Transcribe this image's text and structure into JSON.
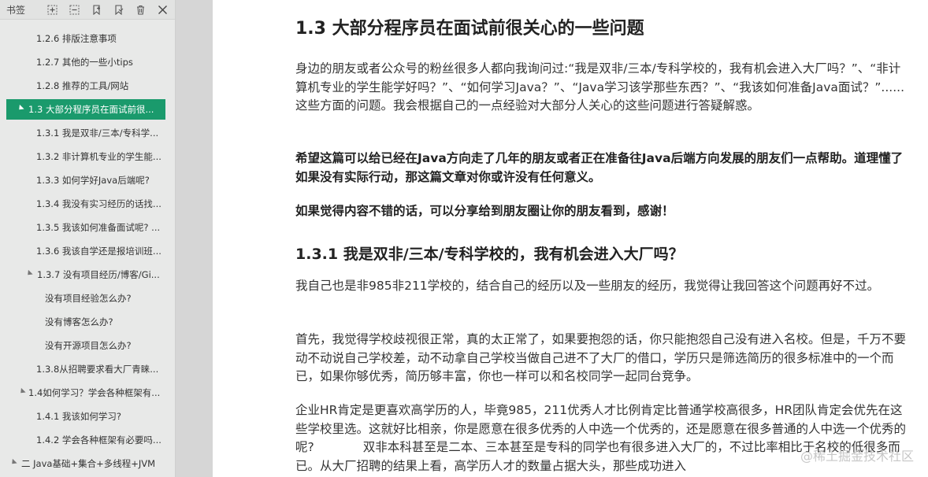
{
  "sidebar": {
    "title": "书签",
    "tools": [
      "expand-all-icon",
      "collapse-all-icon",
      "add-bookmark-icon",
      "bookmark-option-icon",
      "delete-icon",
      "close-icon"
    ],
    "items": [
      {
        "label": "1.2.6 排版注意事项"
      },
      {
        "label": "1.2.7 其他的一些小tips"
      },
      {
        "label": "1.2.8 推荐的工具/网站"
      },
      {
        "label": "1.3 大部分程序员在面试前很..."
      },
      {
        "label": "1.3.1 我是双非/三本/专科学..."
      },
      {
        "label": "1.3.2 非计算机专业的学生能..."
      },
      {
        "label": "1.3.3 如何学好Java后端呢?"
      },
      {
        "label": "1.3.4 我没有实习经历的话找..."
      },
      {
        "label": "1.3.5 我该如何准备面试呢? ..."
      },
      {
        "label": "1.3.6 我该自学还是报培训班..."
      },
      {
        "label": "1.3.7 没有项目经历/博客/Gi..."
      },
      {
        "label": "没有项目经验怎么办?"
      },
      {
        "label": "没有博客怎么办?"
      },
      {
        "label": "没有开源项目怎么办?"
      },
      {
        "label": "1.3.8从招聘要求看大厂青睐..."
      },
      {
        "label": "1.4如何学习？学会各种框架有..."
      },
      {
        "label": "1.4.1 我该如何学习?"
      },
      {
        "label": "1.4.2 学会各种框架有必要吗..."
      },
      {
        "label": "二 Java基础+集合+多线程+JVM"
      }
    ]
  },
  "doc": {
    "h1": "1.3 大部分程序员在面试前很关心的一些问题",
    "p1": "身边的朋友或者公众号的粉丝很多人都向我询问过:“我是双非/三本/专科学校的，我有机会进入大厂吗？”、“非计算机专业的学生能学好吗？”、“如何学习Java？”、“Java学习该学那些东西？”、“我该如何准备Java面试？”......这些方面的问题。我会根据自己的一点经验对大部分人关心的这些问题进行答疑解惑。",
    "p2": "希望这篇可以给已经在Java方向走了几年的朋友或者正在准备往Java后端方向发展的朋友们一点帮助。道理懂了如果没有实际行动，那这篇文章对你或许没有任何意义。",
    "p3": "如果觉得内容不错的话，可以分享给到朋友圈让你的朋友看到，感谢！",
    "h2": "1.3.1 我是双非/三本/专科学校的，我有机会进入大厂吗？",
    "p4": "我自己也是非985非211学校的，结合自己的经历以及一些朋友的经历，我觉得让我回答这个问题再好不过。",
    "p5": "首先，我觉得学校歧视很正常，真的太正常了，如果要抱怨的话，你只能抱怨自己没有进入名校。但是，千万不要动不动说自己学校差，动不动拿自己学校当做自己进不了大厂的借口，学历只是筛选简历的很多标准中的一个而已，如果你够优秀，简历够丰富，你也一样可以和名校同学一起同台竞争。",
    "p6": "企业HR肯定是更喜欢高学历的人，毕竟985，211优秀人才比例肯定比普通学校高很多，HR团队肯定会优先在这些学校里选。这就好比相亲，你是愿意在很多优秀的人中选一个优秀的，还是愿意在很多普通的人中选一个优秀的呢?　　　　双非本科甚至是二本、三本甚至是专科的同学也有很多进入大厂的，不过比率相比于名校的低很多而已。从大厂招聘的结果上看，高学历人才的数量占据大头，那些成功进入"
  },
  "watermark": "@稀土掘金技术社区",
  "colors": {
    "selected_bg": "#1a9a6c",
    "sidebar_bg": "#e8e9e8",
    "gutter": "#d6d6d6"
  }
}
